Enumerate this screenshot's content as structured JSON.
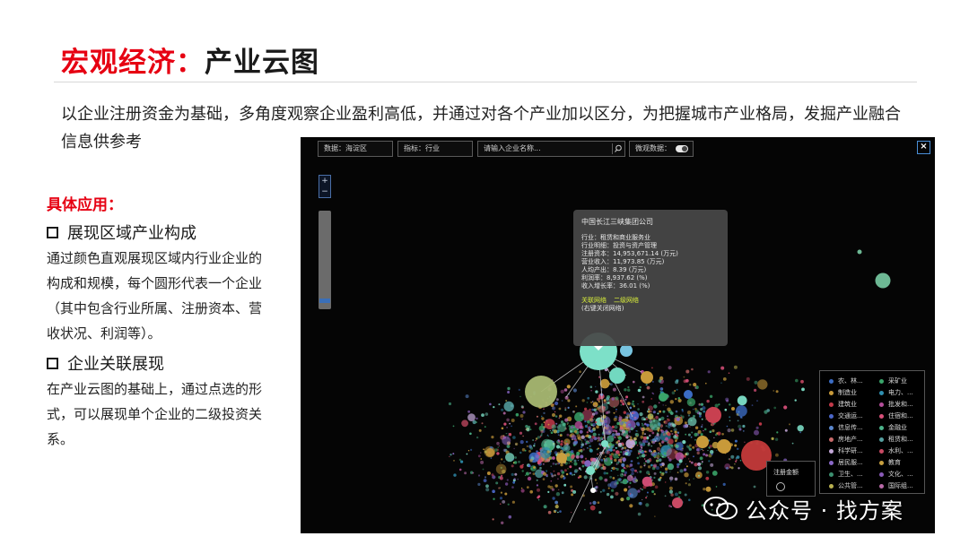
{
  "header": {
    "title_red": "宏观经济：",
    "title_dark": "产业云图"
  },
  "intro_text": "以企业注册资金为基础，多角度观察企业盈利高低，并通过对各个产业加以区分，为把握城市产业格局，发掘产业融合信息供参考",
  "applications": {
    "title": "具体应用：",
    "items": [
      {
        "heading": "展现区域产业构成",
        "desc": "通过颜色直观展现区域内行业企业的构成和规模，每个圆形代表一个企业（其中包含行业所属、注册资本、营收状况、利润等）。"
      },
      {
        "heading": "企业关联展现",
        "desc": "在产业云图的基础上，通过点选的形式，可以展现单个企业的二级投资关系。"
      }
    ]
  },
  "viz": {
    "toolbar": {
      "data_field": "数据：海淀区",
      "index_field": "指标：行业",
      "search_placeholder": "请输入企业名称...",
      "micro_label": "微观数据："
    },
    "zoom": {
      "plus": "+",
      "minus": "−"
    },
    "close_label": "×",
    "tooltip": {
      "company": "中国长江三峡集团公司",
      "lines": [
        "行业：租赁和商业服务业",
        "行业明细：投资与资产管理",
        "注册资本：14,953,671.14 (万元)",
        "营业收入：11,973.85 (万元)",
        "人均产出：8.39 (万元)",
        "利润率：8,937.62 (%)",
        "收入增长率：36.01 (%)"
      ],
      "link_primary": "关联网络",
      "link_secondary": "二级网络",
      "hint": "(右键关闭网络)"
    },
    "legend": [
      {
        "label": "农、林...",
        "color": "#3b6cc4"
      },
      {
        "label": "采矿业",
        "color": "#3aa56a"
      },
      {
        "label": "制造业",
        "color": "#c89a3a"
      },
      {
        "label": "电力、...",
        "color": "#2f8fb0"
      },
      {
        "label": "建筑业",
        "color": "#c23a4a"
      },
      {
        "label": "批发和...",
        "color": "#b44e9a"
      },
      {
        "label": "交通运...",
        "color": "#4b66c8"
      },
      {
        "label": "住宿和...",
        "color": "#d8507a"
      },
      {
        "label": "信息传...",
        "color": "#5a86cc"
      },
      {
        "label": "金融业",
        "color": "#4cb38a"
      },
      {
        "label": "房地产...",
        "color": "#c86a6a"
      },
      {
        "label": "租赁和...",
        "color": "#55a0a0"
      },
      {
        "label": "科学研...",
        "color": "#c4a8d8"
      },
      {
        "label": "水利、...",
        "color": "#c84a64"
      },
      {
        "label": "居民服...",
        "color": "#8a68c8"
      },
      {
        "label": "教育",
        "color": "#c8a040"
      },
      {
        "label": "卫生、...",
        "color": "#3c9070"
      },
      {
        "label": "文化、...",
        "color": "#8a5ab8"
      },
      {
        "label": "公共管...",
        "color": "#b8b050"
      },
      {
        "label": "国际组...",
        "color": "#b86aa8"
      }
    ],
    "amount_label": "注册金额"
  },
  "watermark": "公众号 · 找方案"
}
